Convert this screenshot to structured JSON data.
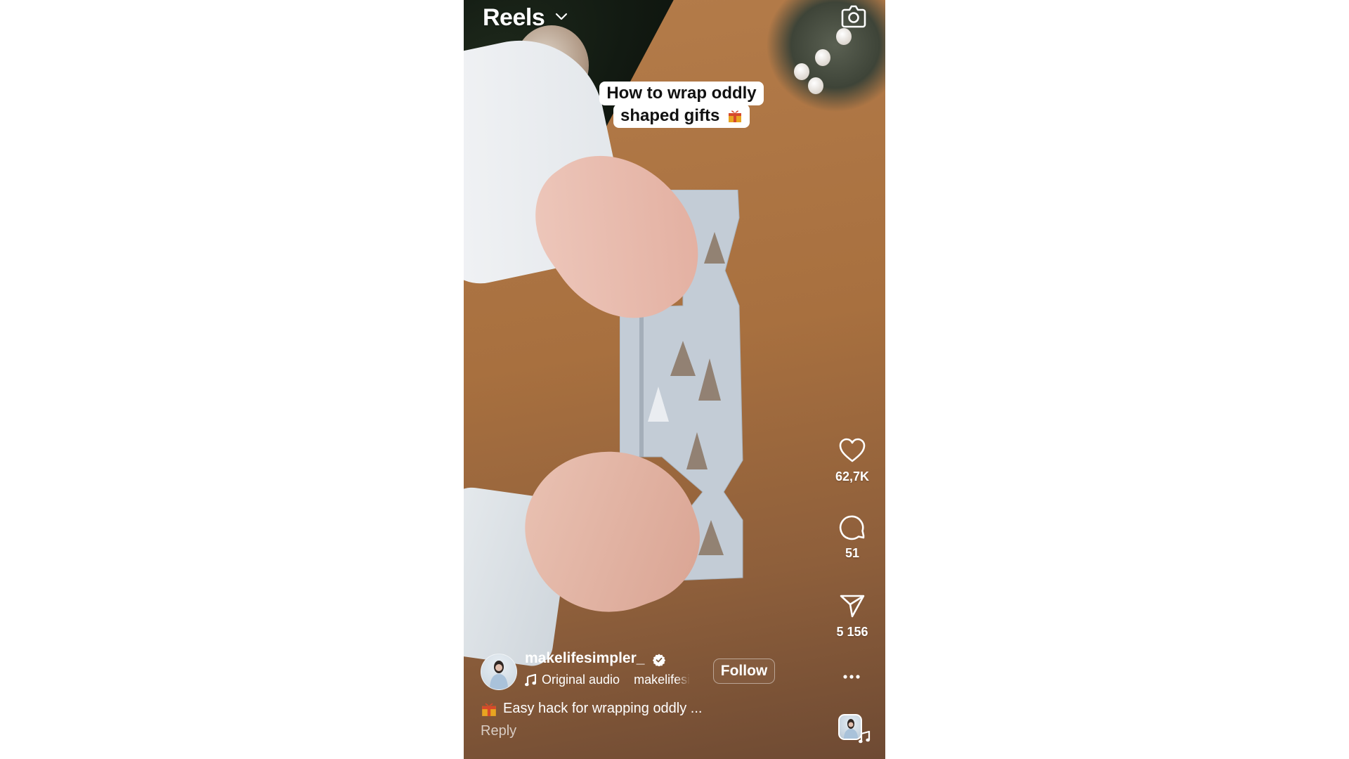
{
  "header": {
    "title": "Reels",
    "title_dropdown_icon": "chevron-down-icon",
    "camera_icon": "camera-icon"
  },
  "video": {
    "description": "Hands wrapping a cracker-shaped gift in light blue paper with tree pattern on a wooden table",
    "sticker_text": {
      "line1": "How to wrap oddly",
      "line2": "shaped gifts",
      "emoji": "wrapped-gift"
    }
  },
  "actions": {
    "like": {
      "icon": "heart-icon",
      "count": "62,7K"
    },
    "comment": {
      "icon": "comment-icon",
      "count": "51"
    },
    "share": {
      "icon": "send-icon",
      "count": "5 156"
    },
    "more": {
      "icon": "more-icon",
      "label": "..."
    }
  },
  "author": {
    "username": "makelifesimpler_",
    "verified": true,
    "follow_label": "Follow"
  },
  "audio": {
    "label": "Original audio",
    "owner": "makelifesimpler_",
    "owner_visible": "makelifes"
  },
  "caption": {
    "emoji": "wrapped-gift",
    "text": "Easy hack for wrapping oddly ...",
    "reply_label": "Reply"
  },
  "colors": {
    "overlay_text": "#ffffff",
    "sticker_bg": "#ffffff",
    "sticker_text": "#111111",
    "wood": "#a8703f"
  }
}
